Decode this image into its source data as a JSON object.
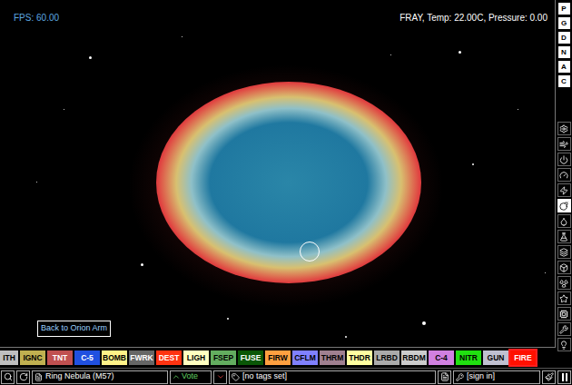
{
  "canvas": {
    "fps": "FPS: 60.00",
    "hud": "FRAY, Temp: 22.00C, Pressure: 0.00",
    "sign": "Back to Orion Arm"
  },
  "menu_buttons": [
    {
      "label": "P"
    },
    {
      "label": "G"
    },
    {
      "label": "D"
    },
    {
      "label": "N"
    },
    {
      "label": "A"
    },
    {
      "label": "C"
    }
  ],
  "categories": [
    {
      "selected": false
    },
    {
      "selected": false
    },
    {
      "selected": false
    },
    {
      "selected": false
    },
    {
      "selected": false
    },
    {
      "selected": true
    },
    {
      "selected": false
    },
    {
      "selected": false
    },
    {
      "selected": false
    },
    {
      "selected": false
    },
    {
      "selected": false
    },
    {
      "selected": false
    },
    {
      "selected": false
    },
    {
      "selected": false
    },
    {
      "selected": false
    }
  ],
  "elements": [
    {
      "label": "ITH",
      "color": "#bfbfbf",
      "selected": false
    },
    {
      "label": "IGNC",
      "color": "#c0b050",
      "selected": false
    },
    {
      "label": "TNT",
      "color": "#c05050",
      "selected": false
    },
    {
      "label": "C-5",
      "color": "#2050e0",
      "selected": false
    },
    {
      "label": "BOMB",
      "color": "#fff288",
      "selected": false
    },
    {
      "label": "FWRK",
      "color": "#666666",
      "selected": false
    },
    {
      "label": "DEST",
      "color": "#ff3311",
      "selected": false
    },
    {
      "label": "LIGH",
      "color": "#ffffc0",
      "selected": false
    },
    {
      "label": "FSEP",
      "color": "#63ad5f",
      "selected": false
    },
    {
      "label": "FUSE",
      "color": "#0a5706",
      "selected": false
    },
    {
      "label": "FIRW",
      "color": "#ffa040",
      "selected": false
    },
    {
      "label": "CFLM",
      "color": "#8080ff",
      "selected": false
    },
    {
      "label": "THRM",
      "color": "#a08090",
      "selected": false
    },
    {
      "label": "THDR",
      "color": "#ffffa0",
      "selected": false
    },
    {
      "label": "LRBD",
      "color": "#aaaaaa",
      "selected": false
    },
    {
      "label": "RBDM",
      "color": "#cccccc",
      "selected": false
    },
    {
      "label": "C-4",
      "color": "#d080e0",
      "selected": false
    },
    {
      "label": "NITR",
      "color": "#20e010",
      "selected": false
    },
    {
      "label": "GUN",
      "color": "#c0c0d0",
      "selected": false
    },
    {
      "label": "FIRE",
      "color": "#ff1000",
      "selected": true
    }
  ],
  "status_bar": {
    "save_name": "Ring Nebula (M57)",
    "vote": "Vote",
    "tags": "[no tags set]",
    "user": "[sign in]"
  }
}
